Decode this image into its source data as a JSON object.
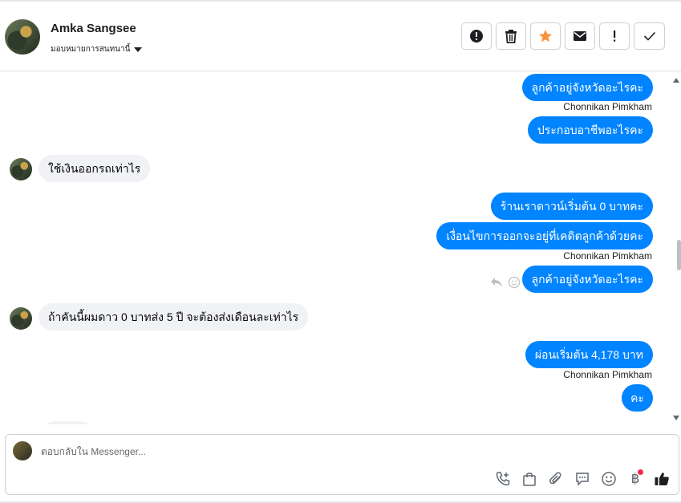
{
  "header": {
    "contact_name": "Amka Sangsee",
    "assign_label": "มอบหมายการสนทนานี้"
  },
  "toolbar": {
    "buttons": [
      {
        "icon": "alert-circle-icon",
        "color": "#1c1e21"
      },
      {
        "icon": "trash-icon",
        "color": "#1c1e21"
      },
      {
        "icon": "star-icon",
        "color": "#f7923b"
      },
      {
        "icon": "envelope-icon",
        "color": "#1c1e21"
      },
      {
        "icon": "exclamation-icon",
        "color": "#1c1e21"
      },
      {
        "icon": "check-icon",
        "color": "#1c1e21"
      }
    ]
  },
  "messages": {
    "m1": "ลูกค้าอยู่จังหวัดอะไรคะ",
    "s1": "Chonnikan Pimkham",
    "m2": "ประกอบอาชีพอะไรคะ",
    "m3": "ใช้เงินออกรถเท่าไร",
    "m4": "ร้านเราดาวน์เริ่มต้น 0 บาทคะ",
    "m5": "เงื่อนไขการออกจะอยู่ที่เคดิตลูกค้าด้วยคะ",
    "s2": "Chonnikan Pimkham",
    "m6": "ลูกค้าอยู่จังหวัดอะไรคะ",
    "m7": "ถ้าคันนี้ผมดาว 0 บาทส่ง 5 ปี จะต้องส่งเดือนละเท่าไร",
    "m8": "ผ่อนเริ่มต้น 4,178 บาท",
    "s3": "Chonnikan Pimkham",
    "m9": "คะ"
  },
  "composer": {
    "placeholder": "ตอบกลับใน Messenger...",
    "baht_symbol": "฿"
  },
  "colors": {
    "outgoing_bubble": "#0084ff",
    "incoming_bubble": "#f0f2f5",
    "like": "#1c1e21",
    "notification_dot": "#f02849"
  }
}
